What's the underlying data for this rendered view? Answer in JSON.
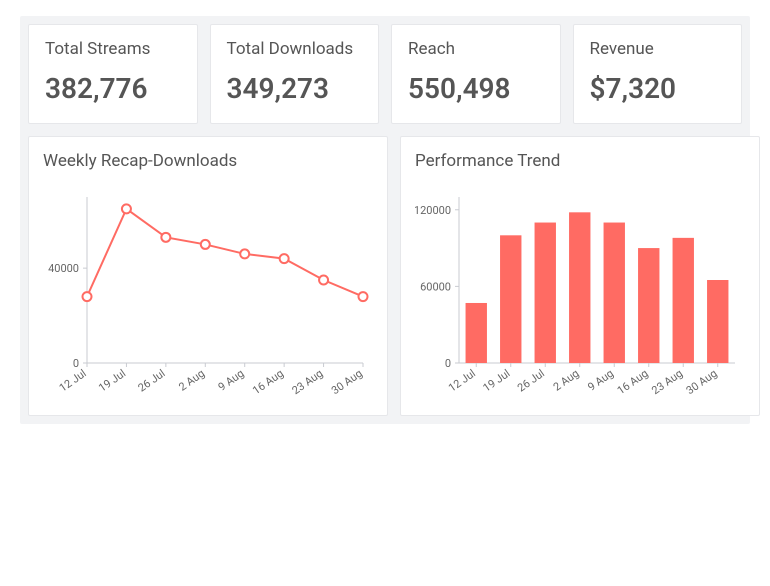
{
  "stats": [
    {
      "key": "total_streams",
      "title": "Total Streams",
      "value": "382,776"
    },
    {
      "key": "total_downloads",
      "title": "Total Downloads",
      "value": "349,273"
    },
    {
      "key": "reach",
      "title": "Reach",
      "value": "550,498"
    },
    {
      "key": "revenue",
      "title": "Revenue",
      "value": "$7,320"
    }
  ],
  "charts": {
    "weekly_recap": {
      "title": "Weekly Recap-Downloads"
    },
    "performance_trend": {
      "title": "Performance Trend"
    }
  },
  "chart_data": [
    {
      "id": "weekly_recap",
      "type": "line",
      "title": "Weekly Recap-Downloads",
      "xlabel": "",
      "ylabel": "",
      "categories": [
        "12 Jul",
        "19 Jul",
        "26 Jul",
        "2 Aug",
        "9 Aug",
        "16 Aug",
        "23 Aug",
        "30 Aug"
      ],
      "values": [
        28000,
        65000,
        53000,
        50000,
        46000,
        44000,
        35000,
        28000
      ],
      "ylim": [
        0,
        70000
      ],
      "yticks": [
        0,
        40000
      ],
      "legend": false,
      "grid": false
    },
    {
      "id": "performance_trend",
      "type": "bar",
      "title": "Performance Trend",
      "xlabel": "",
      "ylabel": "",
      "categories": [
        "12 Jul",
        "19 Jul",
        "26 Jul",
        "2 Aug",
        "9 Aug",
        "16 Aug",
        "23 Aug",
        "30 Aug"
      ],
      "values": [
        47000,
        100000,
        110000,
        118000,
        110000,
        90000,
        98000,
        65000
      ],
      "ylim": [
        0,
        130000
      ],
      "yticks": [
        0,
        60000,
        120000
      ],
      "legend": false,
      "grid": false
    }
  ]
}
